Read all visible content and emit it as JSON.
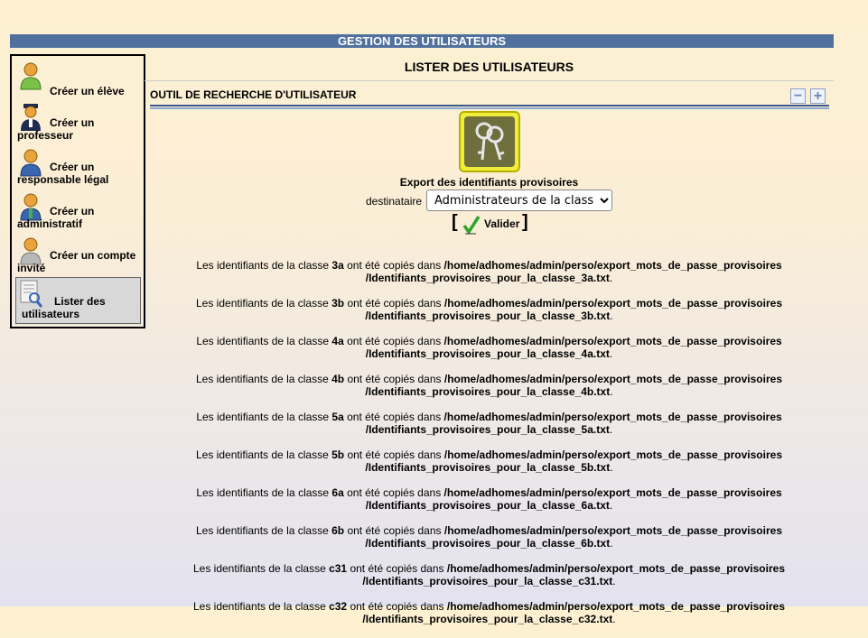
{
  "header": {
    "title": "GESTION DES UTILISATEURS"
  },
  "sidebar": {
    "items": [
      {
        "label": "Créer un élève",
        "icon": "student-icon"
      },
      {
        "label": "Créer un professeur",
        "icon": "teacher-icon"
      },
      {
        "label": "Créer un responsable légal",
        "icon": "parent-icon"
      },
      {
        "label": "Créer un administratif",
        "icon": "admin-staff-icon"
      },
      {
        "label": "Créer un compte invité",
        "icon": "guest-icon"
      },
      {
        "label": "Lister des utilisateurs",
        "icon": "list-users-icon",
        "active": true
      }
    ]
  },
  "main": {
    "title": "LISTER DES UTILISATEURS",
    "search_tool": {
      "title": "OUTIL DE RECHERCHE D'UTILISATEUR",
      "collapse": "−",
      "expand": "+"
    },
    "export": {
      "label": "Export des identifiants provisoires",
      "dest_label": "destinataire",
      "dest_value": "Administrateurs de la classe",
      "submit_label": "Valider",
      "bracket_open": "[",
      "bracket_close": "]"
    },
    "results": {
      "prefix": "Les identifiants de la classe ",
      "middle": " ont été copiés dans ",
      "path": "/home/adhomes/admin/perso/export_mots_de_passe_provisoires",
      "file_prefix": "/Identifiants_provisoires_pour_la_classe_",
      "file_suffix": ".txt",
      "end": ".",
      "classes": [
        "3a",
        "3b",
        "4a",
        "4b",
        "5a",
        "5b",
        "6a",
        "6b",
        "c31",
        "c32"
      ]
    }
  },
  "colors": {
    "header_bar": "#50709e",
    "accent_yellow": "#f0ec3a",
    "check_green": "#2ca52c"
  }
}
